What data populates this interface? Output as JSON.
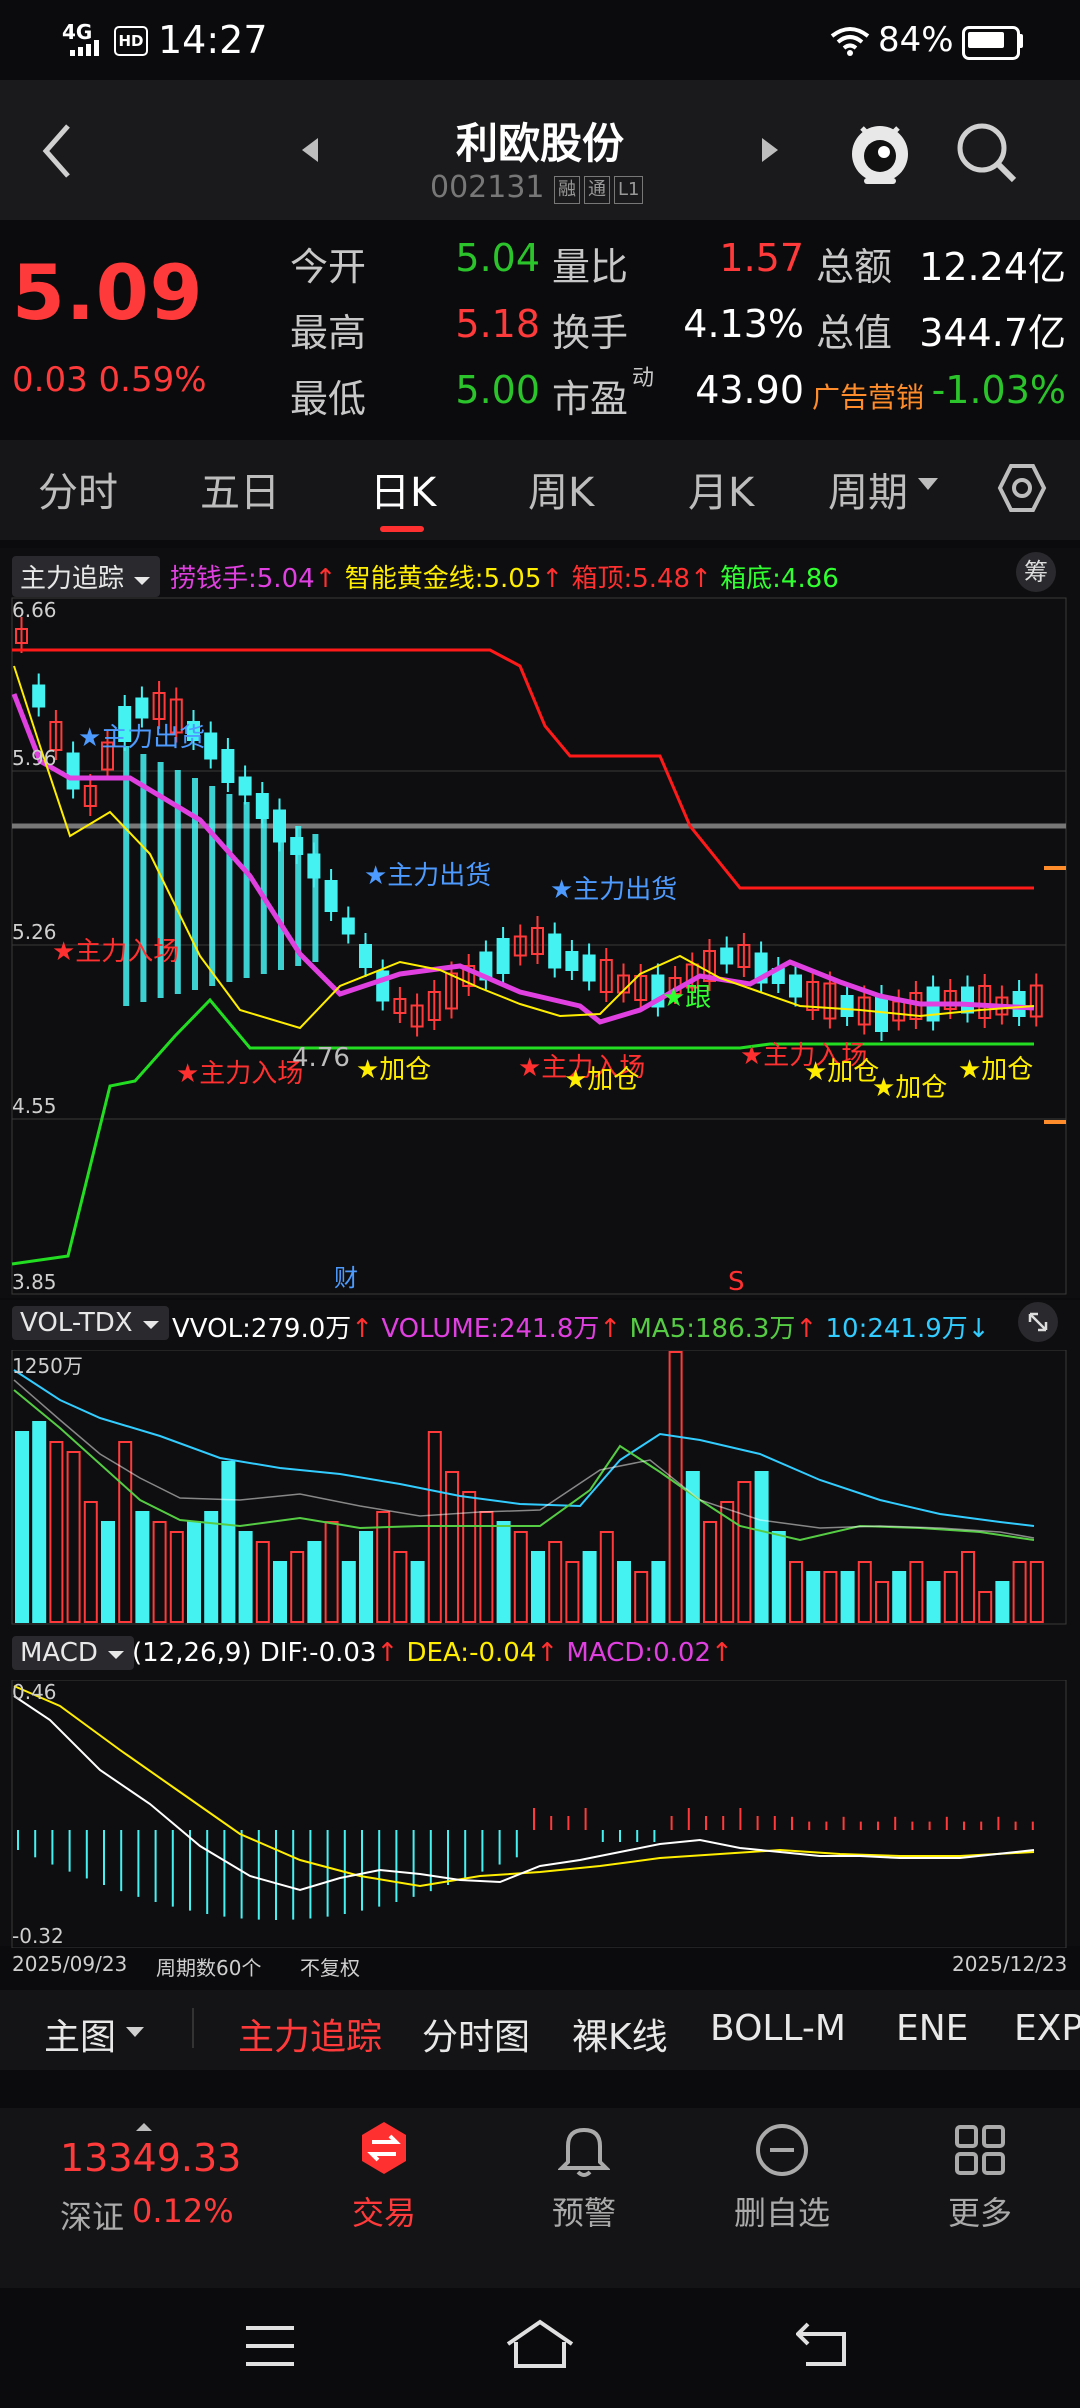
{
  "status_bar": {
    "network": "4G",
    "hd": "HD",
    "time": "14:27",
    "battery": "84%"
  },
  "header": {
    "title": "利欧股份",
    "code": "002131",
    "tags": [
      "融",
      "通",
      "L1"
    ]
  },
  "quote": {
    "price": "5.09",
    "change": "0.03 0.59%",
    "rows": [
      {
        "l1": "今开",
        "v1": "5.04",
        "c1": "green",
        "l2": "量比",
        "v2": "1.57",
        "c2": "red",
        "l3": "总额",
        "v3": "12.24亿",
        "c3": "white"
      },
      {
        "l1": "最高",
        "v1": "5.18",
        "c1": "red",
        "l2": "换手",
        "v2": "4.13%",
        "c2": "white",
        "l3": "总值",
        "v3": "344.7亿",
        "c3": "white"
      },
      {
        "l1": "最低",
        "v1": "5.00",
        "c1": "green",
        "l2": "市盈",
        "sup": "动",
        "v2": "43.90",
        "c2": "white",
        "l3": "广告营销",
        "v3": "-1.03%",
        "c3": "green"
      }
    ]
  },
  "tabs": [
    {
      "label": "分时"
    },
    {
      "label": "五日"
    },
    {
      "label": "日K"
    },
    {
      "label": "周K"
    },
    {
      "label": "月K"
    },
    {
      "label": "周期"
    }
  ],
  "main_chart": {
    "indicator": "主力追踪",
    "chip_label": "筹",
    "legend": [
      {
        "text": "捞钱手:5.04",
        "color": "#e040e0"
      },
      {
        "text": "智能黄金线:5.05",
        "color": "#ffee00"
      },
      {
        "text": "箱顶:5.48",
        "color": "#ff3030"
      },
      {
        "text": "箱底:4.86",
        "color": "#30ff30"
      }
    ],
    "y_labels": [
      "6.66",
      "5.96",
      "5.26",
      "4.55",
      "3.85"
    ],
    "low_mark": "4.76",
    "markers": {
      "fin": "财",
      "s": "S",
      "out": "★主力出货",
      "in": "★主力入场",
      "add": "★加仓",
      "follow": "★跟"
    }
  },
  "volume_chart": {
    "indicator": "VOL-TDX",
    "legend": [
      {
        "text": "VVOL:279.0万",
        "color": "#ffffff"
      },
      {
        "text": "VOLUME:241.8万",
        "color": "#e040e0"
      },
      {
        "text": "MA5:186.3万",
        "color": "#55cc44"
      },
      {
        "text": "10:241.9万",
        "color": "#33ccff"
      }
    ],
    "y_max": "1250万"
  },
  "macd_chart": {
    "indicator": "MACD",
    "legend": [
      {
        "text": "(12,26,9)",
        "color": "#ffffff"
      },
      {
        "text": "DIF:-0.03",
        "color": "#ffffff"
      },
      {
        "text": "DEA:-0.04",
        "color": "#ffee00"
      },
      {
        "text": "MACD:0.02",
        "color": "#e040e0"
      }
    ],
    "y_top": "0.46",
    "y_bottom": "-0.32"
  },
  "x_axis": {
    "start": "2025/09/23",
    "period": "周期数60个",
    "adjust": "不复权",
    "end": "2025/12/23"
  },
  "indicator_bar": {
    "main": "主图",
    "items": [
      "主力追踪",
      "分时图",
      "裸K线",
      "BOLL-M",
      "ENE",
      "EXP"
    ]
  },
  "bottom_index": {
    "value": "13349.33",
    "name": "深证",
    "pct": "0.12%"
  },
  "bottom_nav": [
    {
      "label": "交易"
    },
    {
      "label": "预警"
    },
    {
      "label": "删自选"
    },
    {
      "label": "更多"
    }
  ],
  "colors": {
    "up": "#ff3a3a",
    "down": "#2bc42b",
    "cyan": "#44f2f2",
    "bg": "#0b0b0d"
  }
}
